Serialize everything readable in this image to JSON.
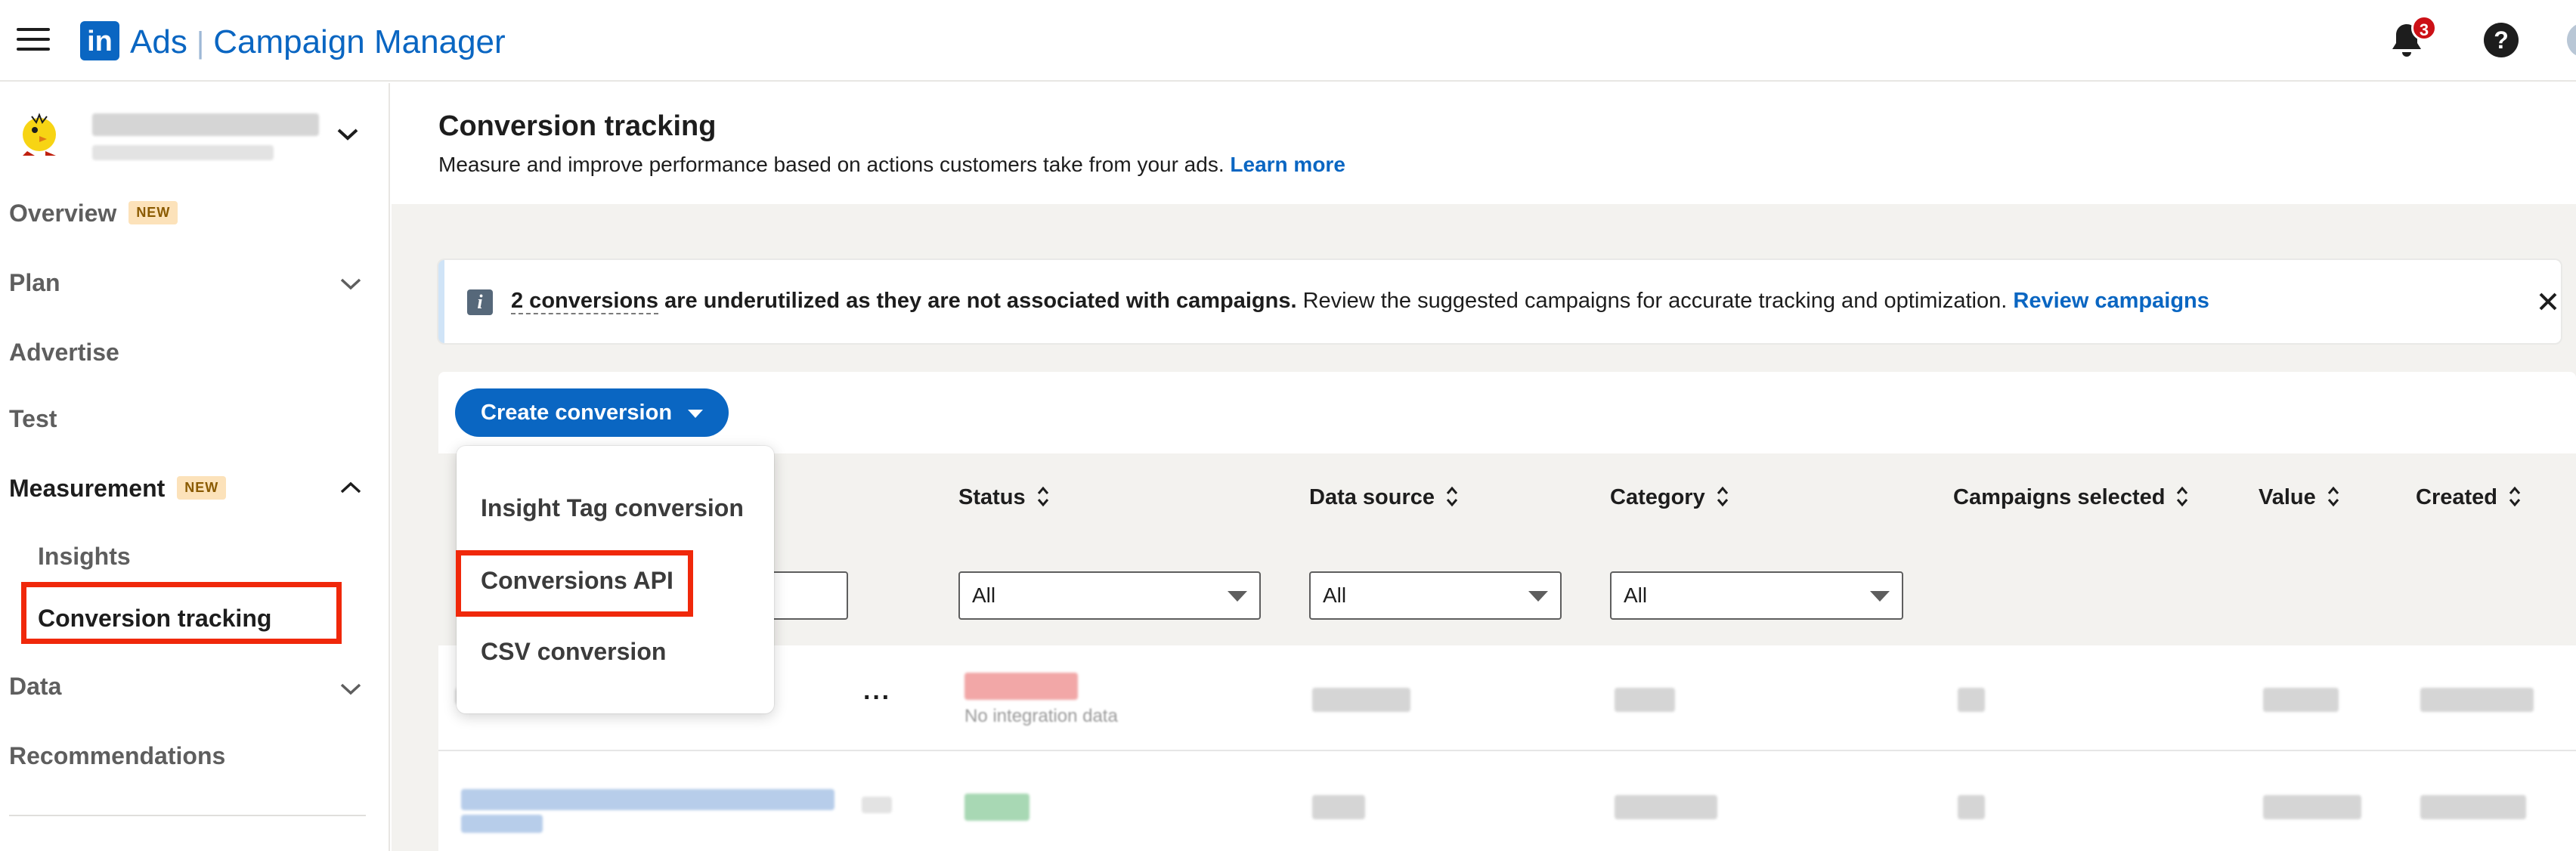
{
  "header": {
    "logo_text": "in",
    "product": "Ads",
    "app_name": "Campaign Manager",
    "notification_count": "3",
    "help_label": "?",
    "colors": {
      "brand": "#0a66c2",
      "badge": "#cc1016"
    }
  },
  "sidebar": {
    "new_badge": "NEW",
    "items": [
      {
        "label": "Overview",
        "badge": "NEW"
      },
      {
        "label": "Plan"
      },
      {
        "label": "Advertise"
      },
      {
        "label": "Test"
      },
      {
        "label": "Measurement",
        "badge": "NEW"
      },
      {
        "label": "Insights"
      },
      {
        "label": "Conversion tracking",
        "selected": true
      },
      {
        "label": "Data"
      },
      {
        "label": "Recommendations"
      }
    ]
  },
  "page": {
    "title": "Conversion tracking",
    "subtitle": "Measure and improve performance based on actions customers take from your ads.",
    "learn_more": "Learn more"
  },
  "alert": {
    "icon": "info-icon",
    "count_text": "2 conversions",
    "bold_text": "are underutilized as they are not associated with campaigns.",
    "text": "Review the suggested campaigns for accurate tracking and optimization.",
    "link": "Review campaigns"
  },
  "toolbar": {
    "create_label": "Create conversion"
  },
  "menu": {
    "items": [
      "Insight Tag conversion",
      "Conversions API",
      "CSV conversion"
    ]
  },
  "table": {
    "columns": [
      "Status",
      "Data source",
      "Category",
      "Campaigns selected",
      "Value",
      "Created"
    ],
    "filters": {
      "status": "All",
      "data_source": "All",
      "category": "All"
    },
    "row1_status_note": "No integration data",
    "more_label": "···"
  },
  "highlight_color": "#f0280a"
}
